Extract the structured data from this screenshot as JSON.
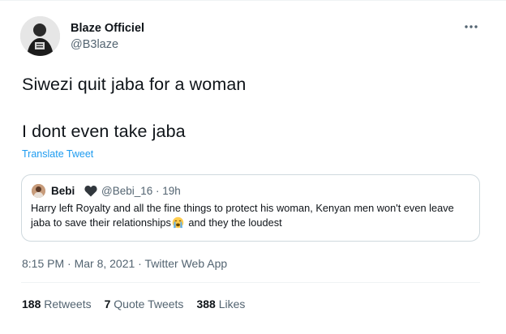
{
  "author": {
    "name": "Blaze Officiel",
    "handle": "@B3laze",
    "avatar": "avatar"
  },
  "menu": {
    "icon": "more-dots-icon"
  },
  "tweet": {
    "line1": "Siwezi quit jaba for a woman",
    "line2": "I dont even take jaba"
  },
  "translate_label": "Translate Tweet",
  "quoted": {
    "name": "Bebi",
    "badge_icon": "black-heart-icon",
    "handle_time": "@Bebi_16 · 19h",
    "text_part1": "Harry left Royalty and all the fine things to protect his woman, Kenyan men won't even leave jaba to save their relationships",
    "emoji_icon": "crying-face-icon",
    "text_part2": " and they the loudest"
  },
  "timestamp": "8:15 PM · Mar 8, 2021 · Twitter Web App",
  "stats": {
    "retweets_count": "188",
    "retweets_label": "Retweets",
    "quotes_count": "7",
    "quotes_label": "Quote Tweets",
    "likes_count": "388",
    "likes_label": "Likes"
  },
  "colors": {
    "link": "#1d9bf0",
    "secondary_text": "#536471",
    "primary_text": "#0f1419",
    "border": "#cfd9de"
  }
}
